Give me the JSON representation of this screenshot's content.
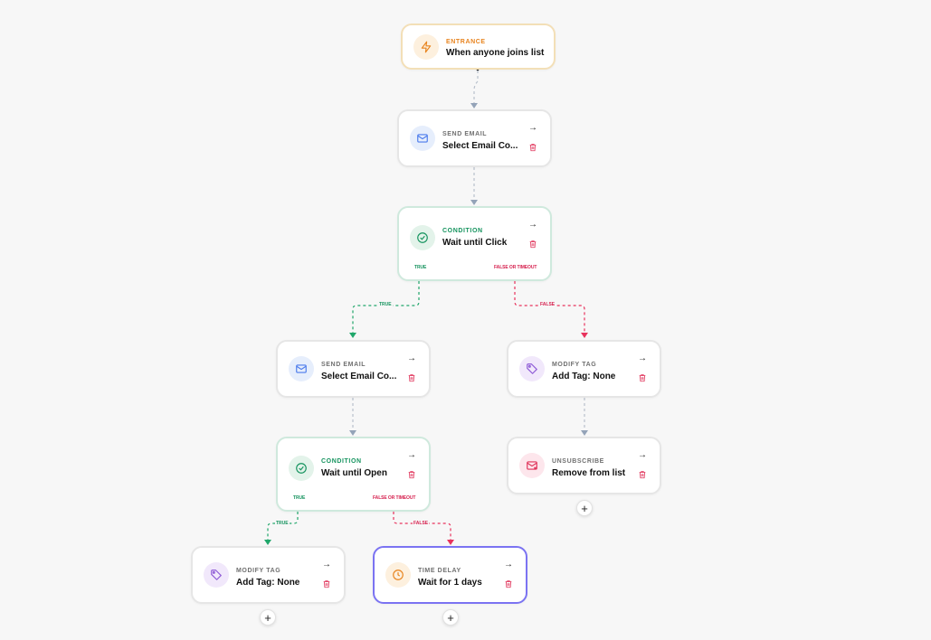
{
  "flow": {
    "entrance": {
      "title": "ENTRANCE",
      "subtitle": "When anyone joins list"
    },
    "send_email_1": {
      "title": "SEND EMAIL",
      "subtitle": "Select Email Co..."
    },
    "condition_1": {
      "title": "CONDITION",
      "subtitle": "Wait until Click",
      "true_label": "TRUE",
      "false_label": "FALSE OR TIMEOUT"
    },
    "send_email_2": {
      "title": "SEND EMAIL",
      "subtitle": "Select Email Co..."
    },
    "modify_tag_1": {
      "title": "MODIFY TAG",
      "subtitle": "Add Tag: None"
    },
    "condition_2": {
      "title": "CONDITION",
      "subtitle": "Wait until Open",
      "true_label": "TRUE",
      "false_label": "FALSE OR TIMEOUT"
    },
    "unsubscribe": {
      "title": "UNSUBSCRIBE",
      "subtitle": "Remove from list"
    },
    "modify_tag_2": {
      "title": "MODIFY TAG",
      "subtitle": "Add Tag: None"
    },
    "time_delay": {
      "title": "TIME DELAY",
      "subtitle": "Wait for 1 days"
    }
  },
  "edges": {
    "true_label": "TRUE",
    "false_label": "FALSE"
  },
  "ui": {
    "next_arrow": "→",
    "add_step": "+"
  },
  "colors": {
    "entrance": "#e8831d",
    "email": "#4b7bec",
    "condition": "#15935e",
    "tag": "#8e5bd6",
    "unsubscribe": "#e0335a",
    "delay": "#e8831d",
    "true_branch": "#21a76b",
    "false_branch": "#e8335d",
    "connector": "#b8c0cc",
    "selected_border": "#7b73f2"
  },
  "icons": {
    "entrance": "lightning-icon",
    "email": "mail-icon",
    "condition": "check-circle-icon",
    "tag": "tag-icon",
    "unsubscribe": "mail-x-icon",
    "delay": "clock-icon",
    "delete": "trash-icon",
    "next": "arrow-right-icon"
  }
}
